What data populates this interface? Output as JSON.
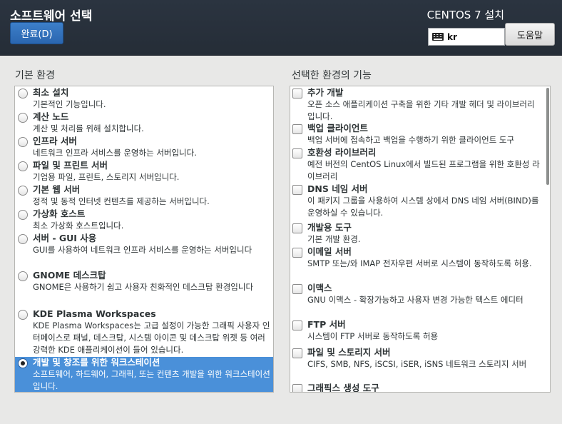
{
  "header": {
    "title": "소프트웨어 선택",
    "done_label": "완료(D)",
    "product_title": "CENTOS 7 설치",
    "keyboard_layout": "kr",
    "help_label": "도움말"
  },
  "base_env": {
    "label": "기본 환경",
    "items": [
      {
        "name": "최소 설치",
        "desc": "기본적인 기능입니다.",
        "selected": false
      },
      {
        "name": "계산 노드",
        "desc": "계산 및 처리를 위해 설치합니다.",
        "selected": false
      },
      {
        "name": "인프라 서버",
        "desc": "네트워크 인프라 서비스를 운영하는 서버입니다.",
        "selected": false
      },
      {
        "name": "파일 및 프린트 서버",
        "desc": "기업용 파일, 프린트, 스토리지 서버입니다.",
        "selected": false
      },
      {
        "name": "기본 웹 서버",
        "desc": "정적 및 동적 인터넷 컨텐츠를 제공하는 서버입니다.",
        "selected": false
      },
      {
        "name": "가상화 호스트",
        "desc": "최소 가상화 호스트입니다.",
        "selected": false
      },
      {
        "name": "서버 - GUI 사용",
        "desc": "GUI를 사용하여 네트워크 인프라 서비스를 운영하는 서버입니다",
        "selected": false
      },
      {
        "name": "GNOME 데스크탑",
        "desc": "GNOME은 사용하기 쉽고 사용자 친화적인 데스크탑 환경입니다",
        "selected": false
      },
      {
        "name": "KDE Plasma Workspaces",
        "desc": "KDE Plasma Workspaces는 고급 설정이 가능한 그래픽 사용자 인터페이스로 패널, 데스크탑, 시스템 아이콘 및 데스크탑 위젯 등 여러 강력한 KDE 애플리케이션이 들어 있습니다.",
        "selected": false
      },
      {
        "name": "개발 및 창조를 위한 워크스테이션",
        "desc": "소프트웨어, 하드웨어, 그래픽, 또는 컨텐츠 개발을 위한 워크스테이션입니다.",
        "selected": true
      }
    ]
  },
  "addons": {
    "label": "선택한 환경의 기능",
    "items": [
      {
        "name": "추가 개발",
        "desc": "오픈 소스 애플리케이션 구축을 위한 기타 개발 헤더 및 라이브러리입니다."
      },
      {
        "name": "백업 클라이언트",
        "desc": "백업 서버에 접속하고 백업을 수행하기 위한 클라이언트 도구"
      },
      {
        "name": "호환성 라이브러리",
        "desc": "예전 버전의 CentOS Linux에서 빌드된 프로그램을 위한 호환성 라이브러리"
      },
      {
        "name": "DNS 네임 서버",
        "desc": "이 패키지 그룹을 사용하여 시스템 상에서 DNS 네임 서버(BIND)를 운영하실 수 있습니다."
      },
      {
        "name": "개발용 도구",
        "desc": "기본 개발 환경."
      },
      {
        "name": "이메일 서버",
        "desc": "SMTP 또는/와 IMAP 전자우편 서버로 시스템이 동작하도록 허용."
      },
      {
        "name": "이맥스",
        "desc": "GNU 이맥스 - 확장가능하고 사용자 변경 가능한 텍스트 에디터"
      },
      {
        "name": "FTP 서버",
        "desc": "시스템이 FTP 서버로 동작하도록 허용"
      },
      {
        "name": "파일 및 스토리지 서버",
        "desc": "CIFS, SMB, NFS, iSCSI, iSER, iSNS 네트워크 스토리지 서버"
      },
      {
        "name": "그래픽스 생성 도구",
        "desc": ""
      }
    ]
  }
}
